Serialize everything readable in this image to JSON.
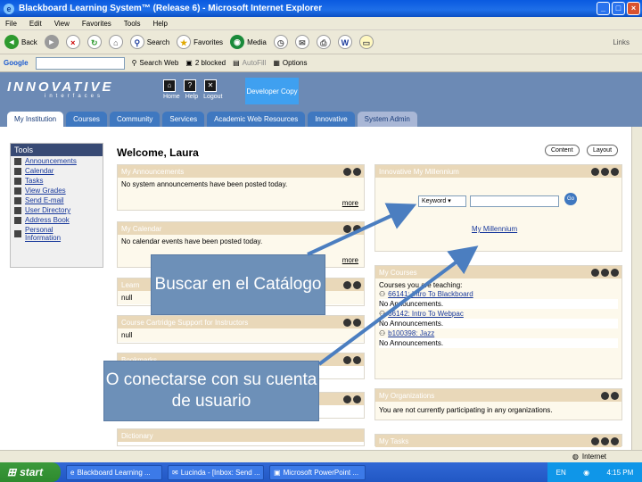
{
  "window": {
    "title": "Blackboard Learning System™ (Release 6) - Microsoft Internet Explorer"
  },
  "menu": [
    "File",
    "Edit",
    "View",
    "Favorites",
    "Tools",
    "Help"
  ],
  "toolbar": {
    "back": "Back",
    "search": "Search",
    "favorites": "Favorites",
    "media": "Media",
    "links": "Links"
  },
  "googlebar": {
    "brand": "Google",
    "search_web": "Search Web",
    "blocked": "2 blocked",
    "autofill": "AutoFill",
    "options": "Options"
  },
  "header": {
    "logo": "INNOVATIVE",
    "logo_sub": "interfaces",
    "icons": [
      "Home",
      "Help",
      "Logout"
    ],
    "dev_button": "Developer Copy",
    "tabs": [
      "My Institution",
      "Courses",
      "Community",
      "Services",
      "Academic Web Resources",
      "Innovative",
      "System Admin"
    ]
  },
  "tools": {
    "title": "Tools",
    "items": [
      "Announcements",
      "Calendar",
      "Tasks",
      "View Grades",
      "Send E-mail",
      "User Directory",
      "Address Book",
      "Personal Information"
    ]
  },
  "welcome": "Welcome, Laura",
  "buttons": {
    "content": "Content",
    "layout": "Layout"
  },
  "modules": {
    "announcements": {
      "title": "My Announcements",
      "body": "No system announcements have been posted today.",
      "more": "more"
    },
    "calendar": {
      "title": "My Calendar",
      "body": "No calendar events have been posted today.",
      "more": "more"
    },
    "learn": {
      "title": "Learn",
      "body": "null"
    },
    "cartridge": {
      "title": "Course Cartridge Support for Instructors",
      "body": "null"
    },
    "bookmarks": {
      "title": "Bookmarks"
    },
    "dictionary": {
      "title": "Dictionary"
    },
    "millennium": {
      "title": "Innovative My Millennium",
      "select": "Keyword",
      "go": "Go",
      "link": "My Millennium"
    },
    "courses": {
      "title": "My Courses",
      "heading": "Courses you are teaching:",
      "items": [
        {
          "name": "66141: Intro To Blackboard",
          "note": "No Announcements."
        },
        {
          "name": "66142: Intro To Webpac",
          "note": "No Announcements."
        },
        {
          "name": "b100398: Jazz",
          "note": "No Announcements."
        }
      ]
    },
    "organizations": {
      "title": "My Organizations",
      "body": "You are not currently participating in any organizations."
    },
    "tasks": {
      "title": "My Tasks"
    }
  },
  "callouts": {
    "catalog": "Buscar en el Catálogo",
    "login": "O conectarse con su cuenta de usuario"
  },
  "status": {
    "zone": "Internet"
  },
  "taskbar": {
    "start": "start",
    "tasks": [
      "Blackboard Learning ...",
      "Lucinda - [Inbox: Send ...",
      "Microsoft PowerPoint ..."
    ],
    "lang": "EN",
    "time": "4:15 PM"
  },
  "colors": {
    "header": "#6c8ab5",
    "module_head": "#e9d8b9",
    "callout": "#6d90b8",
    "arrow": "#4b7ec0"
  }
}
